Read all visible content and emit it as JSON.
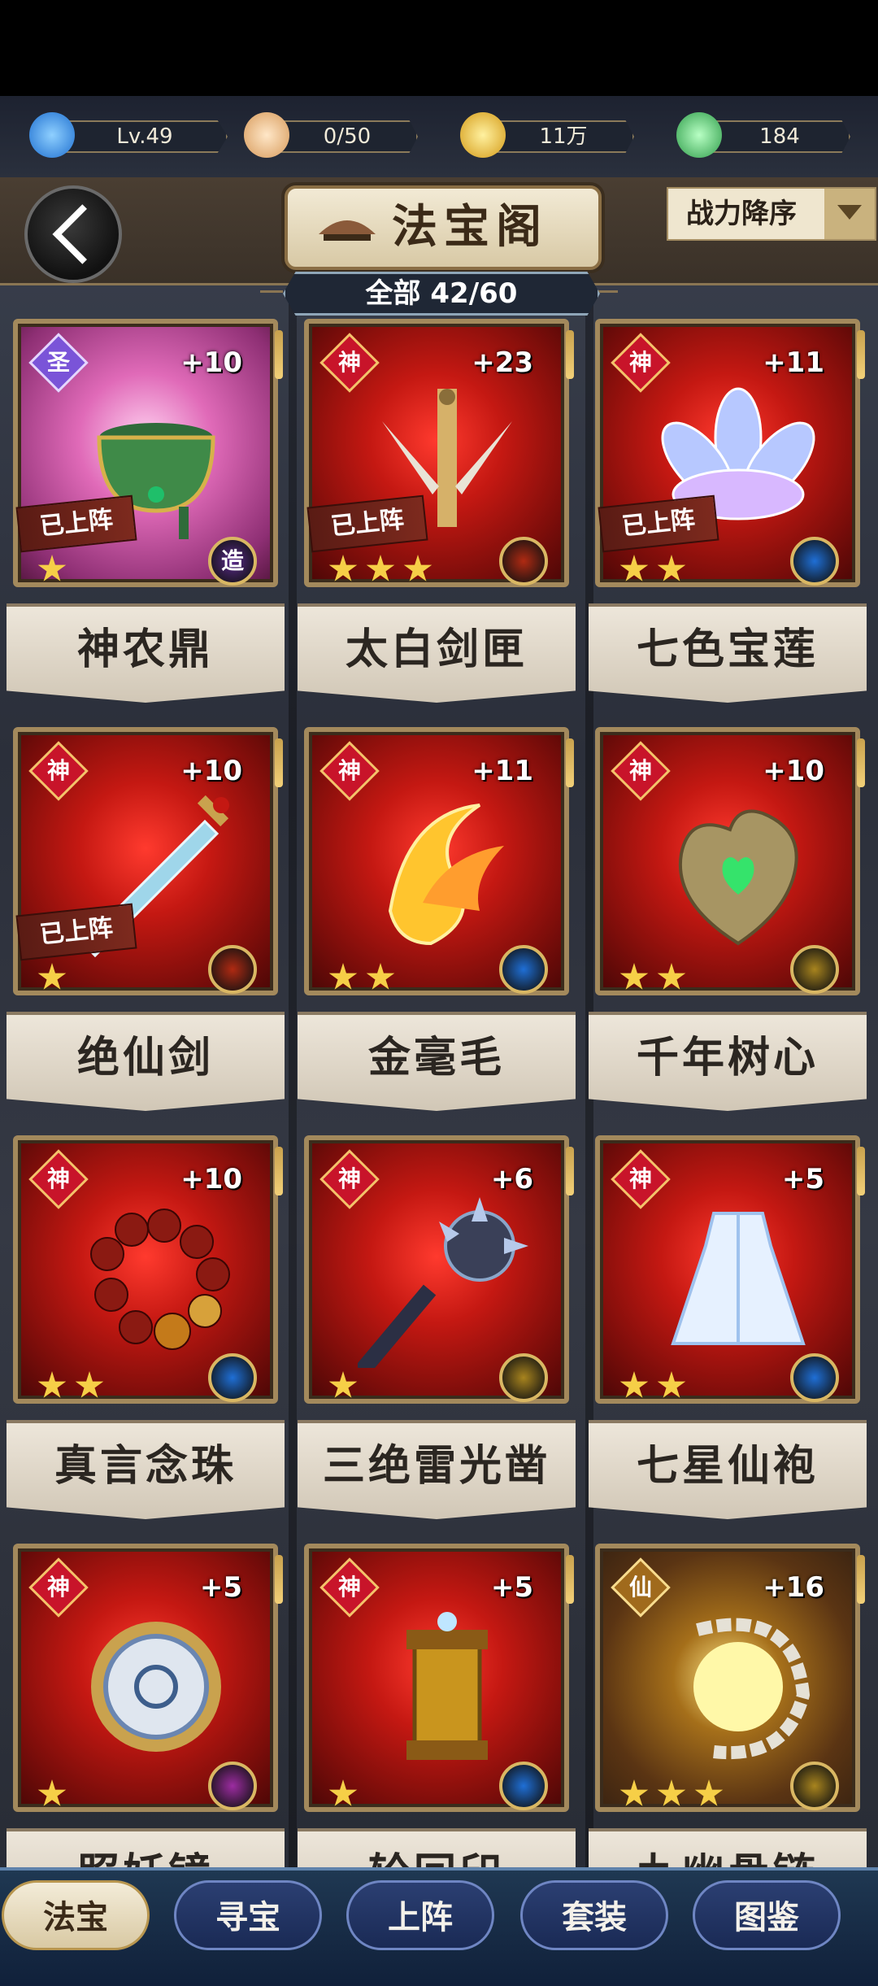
{
  "resources": [
    {
      "name": "level",
      "value": "Lv.49",
      "icon": "dragon-icon",
      "color": "#3aa5ff"
    },
    {
      "name": "stamina",
      "value": "0/50",
      "icon": "bun-icon",
      "color": "#f2c995"
    },
    {
      "name": "coins",
      "value": "11万",
      "icon": "coin-icon",
      "color": "#f0c63c"
    },
    {
      "name": "jade",
      "value": "184",
      "icon": "jade-icon",
      "color": "#5fe07a"
    }
  ],
  "header": {
    "title": "法宝阁",
    "sort_label": "战力降序",
    "count_label": "全部 42/60"
  },
  "cards": [
    {
      "name": "神农鼎",
      "grade": "圣",
      "plus": "+10",
      "deployed": "已上阵",
      "stars": 1,
      "theme": "pink",
      "element_color": "#5b2a8c",
      "element_icon": "craft-icon",
      "element_text": "造",
      "item_icon": "cauldron-icon"
    },
    {
      "name": "太白剑匣",
      "grade": "神",
      "plus": "+23",
      "deployed": "已上阵",
      "stars": 3,
      "theme": "red",
      "element_color": "#b02a12",
      "element_icon": "fire-icon",
      "item_icon": "sword-case-icon"
    },
    {
      "name": "七色宝莲",
      "grade": "神",
      "plus": "+11",
      "deployed": "已上阵",
      "stars": 2,
      "theme": "red",
      "element_color": "#1f6fd6",
      "element_icon": "water-icon",
      "item_icon": "lotus-icon"
    },
    {
      "name": "绝仙剑",
      "grade": "神",
      "plus": "+10",
      "deployed": "已上阵",
      "stars": 1,
      "theme": "red",
      "element_color": "#b02a12",
      "element_icon": "fire-icon",
      "item_icon": "sword-icon"
    },
    {
      "name": "金毫毛",
      "grade": "神",
      "plus": "+11",
      "deployed": "",
      "stars": 2,
      "theme": "red",
      "element_color": "#1f6fd6",
      "element_icon": "water-icon",
      "item_icon": "golden-hair-icon"
    },
    {
      "name": "千年树心",
      "grade": "神",
      "plus": "+10",
      "deployed": "",
      "stars": 2,
      "theme": "red",
      "element_color": "#a8841e",
      "element_icon": "metal-icon",
      "item_icon": "heart-icon"
    },
    {
      "name": "真言念珠",
      "grade": "神",
      "plus": "+10",
      "deployed": "",
      "stars": 2,
      "theme": "red",
      "element_color": "#1f6fd6",
      "element_icon": "water-icon",
      "item_icon": "beads-icon"
    },
    {
      "name": "三绝雷光凿",
      "grade": "神",
      "plus": "+6",
      "deployed": "",
      "stars": 1,
      "theme": "red",
      "element_color": "#a8841e",
      "element_icon": "metal-icon",
      "item_icon": "mace-icon"
    },
    {
      "name": "七星仙袍",
      "grade": "神",
      "plus": "+5",
      "deployed": "",
      "stars": 2,
      "theme": "red",
      "element_color": "#1f6fd6",
      "element_icon": "water-icon",
      "item_icon": "robe-icon"
    },
    {
      "name": "照妖镜",
      "grade": "神",
      "plus": "+5",
      "deployed": "",
      "stars": 1,
      "theme": "red",
      "element_color": "#9c2ca1",
      "element_icon": "shadow-icon",
      "item_icon": "mirror-icon"
    },
    {
      "name": "轮回印",
      "grade": "神",
      "plus": "+5",
      "deployed": "",
      "stars": 1,
      "theme": "red",
      "element_color": "#1f6fd6",
      "element_icon": "water-icon",
      "item_icon": "seal-icon"
    },
    {
      "name": "九幽骨链",
      "grade": "仙",
      "plus": "+16",
      "deployed": "",
      "stars": 3,
      "theme": "gold",
      "element_color": "#a8841e",
      "element_icon": "metal-icon",
      "item_icon": "bone-chain-icon"
    }
  ],
  "nav": {
    "tabs": [
      "法宝",
      "寻宝",
      "上阵",
      "套装",
      "图鉴"
    ],
    "active": 0
  }
}
